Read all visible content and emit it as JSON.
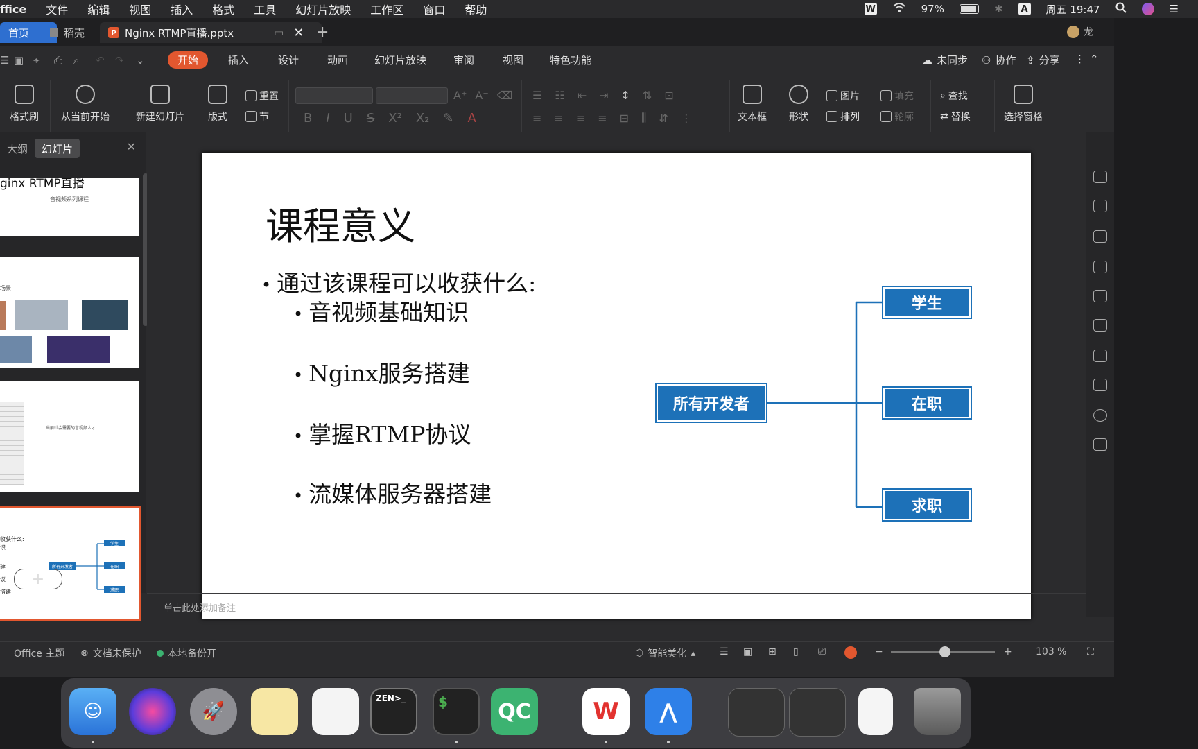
{
  "menubar": {
    "app": "ffice",
    "items": [
      "文件",
      "编辑",
      "视图",
      "插入",
      "格式",
      "工具",
      "幻灯片放映",
      "工作区",
      "窗口",
      "帮助"
    ],
    "battery": "97%",
    "input_method": "A",
    "clock": "周五 19:47"
  },
  "tabs": {
    "home": "首页",
    "daoke": "稻壳",
    "file": "Nginx RTMP直播.pptx",
    "user": "龙"
  },
  "ribbon_tabs": [
    "开始",
    "插入",
    "设计",
    "动画",
    "幻灯片放映",
    "审阅",
    "视图",
    "特色功能"
  ],
  "sync": {
    "unsynced": "未同步",
    "collab": "协作",
    "share": "分享"
  },
  "ribbon": {
    "format_painter": "格式刷",
    "play_from_current": "从当前开始",
    "new_slide": "新建幻灯片",
    "layout": "版式",
    "reset": "重置",
    "section": "节",
    "textbox": "文本框",
    "shape": "形状",
    "picture": "图片",
    "fill": "填充",
    "arrange": "排列",
    "outline": "轮廓",
    "find": "查找",
    "replace": "替换",
    "selection_pane": "选择窗格"
  },
  "leftpanel": {
    "tab_outline": "大纲",
    "tab_slides": "幻灯片",
    "thumb1_title": "ginx RTMP直播",
    "thumb1_sub": "音视频系列课程",
    "thumb2_label": "场景",
    "thumb3_text": "当前社会需要的音视频人才",
    "thumb4_line1": "收获什么:",
    "thumb4_line2": "识",
    "thumb4_line3": "建",
    "thumb4_line4": "议",
    "thumb4_line5": "搭建",
    "thumb4_node_center": "所有开发者",
    "thumb4_node_top": "学生",
    "thumb4_node_mid": "在职",
    "thumb4_node_bottom": "求职"
  },
  "slide": {
    "title": "课程意义",
    "lead": "通过该课程可以收获什么:",
    "bullets": [
      "音视频基础知识",
      "Nginx服务搭建",
      "掌握RTMP协议",
      "流媒体服务器搭建"
    ],
    "node_center": "所有开发者",
    "node_top": "学生",
    "node_mid": "在职",
    "node_bottom": "求职",
    "line_color": "#1d71b8"
  },
  "notes_placeholder": "单击此处添加备注",
  "status": {
    "theme": "Office 主题",
    "protect": "文档未保护",
    "backup": "本地备份开",
    "beautify": "智能美化",
    "zoom": "103 %"
  },
  "colors": {
    "accent": "#e2572f",
    "node": "#1d71b8",
    "tab_home": "#2e6fd0"
  }
}
